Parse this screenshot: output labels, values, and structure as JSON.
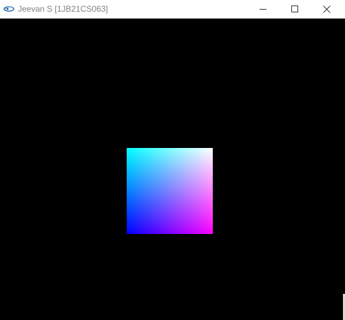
{
  "window": {
    "title": "Jeevan S [1JB21CS063]",
    "icon": "glut-app-icon",
    "controls": {
      "minimize": "minimize-icon",
      "maximize": "maximize-icon",
      "close": "close-icon"
    }
  },
  "canvas": {
    "background": "#000000",
    "square_corner_colors": {
      "top_left": "#00ffff",
      "top_right": "#ffffff",
      "bottom_left": "#0000ff",
      "bottom_right": "#ff00ff"
    }
  }
}
